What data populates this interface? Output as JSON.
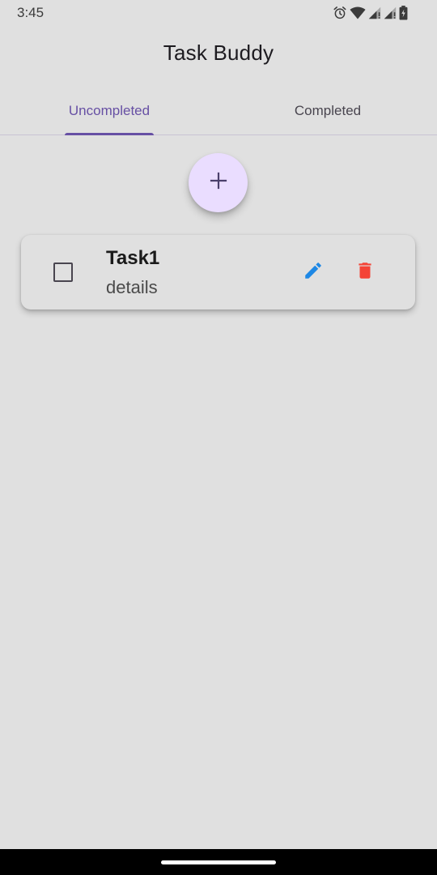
{
  "status_bar": {
    "time": "3:45",
    "icons": [
      "alarm-icon",
      "wifi-icon",
      "signal-icon",
      "signal-icon",
      "battery-charging-icon"
    ]
  },
  "app": {
    "title": "Task Buddy"
  },
  "tabs": [
    {
      "label": "Uncompleted",
      "selected": true
    },
    {
      "label": "Completed",
      "selected": false
    }
  ],
  "fab": {
    "icon": "plus-icon"
  },
  "tasks": [
    {
      "title": "Task1",
      "details": "details",
      "checked": false
    }
  ],
  "colors": {
    "background": "#e0e0e0",
    "accent": "#6750a4",
    "fab_background": "#eaddff",
    "edit": "#1e88e5",
    "delete": "#f44336"
  }
}
